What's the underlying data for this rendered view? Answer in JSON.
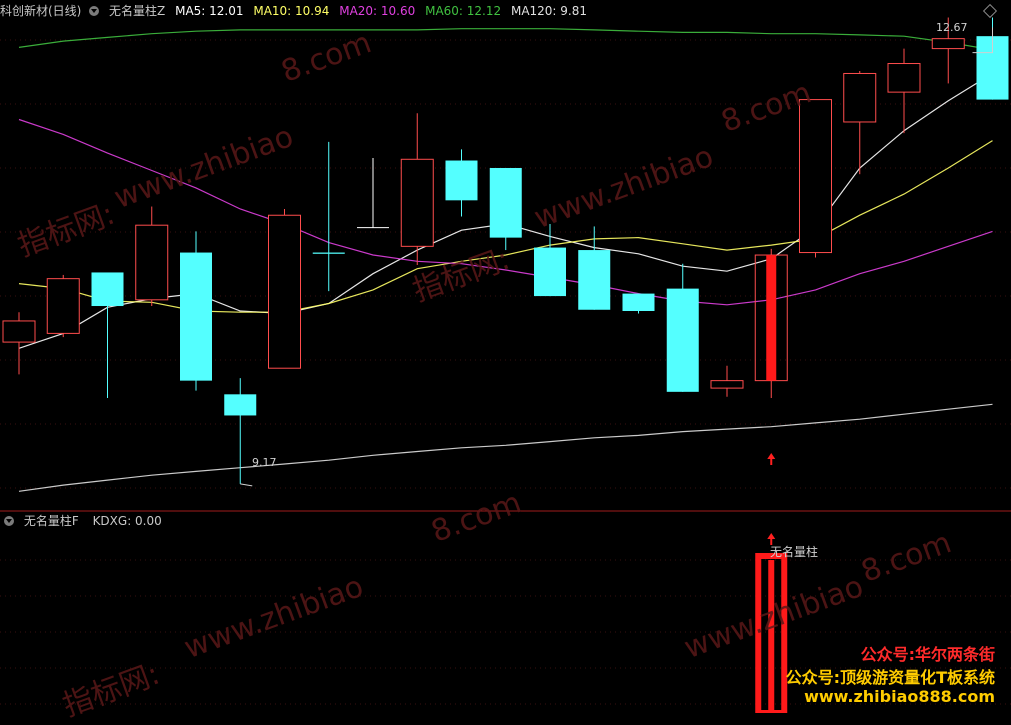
{
  "top_panel": {
    "title": "科创新材(日线)",
    "indicator": "无名量柱Z",
    "ma5": "MA5: 12.01",
    "ma10": "MA10: 10.94",
    "ma20": "MA20: 10.60",
    "ma60": "MA60: 12.12",
    "ma120": "MA120: 9.81",
    "high_label": "12.67",
    "low_label": "9.17"
  },
  "bottom_panel": {
    "indicator": "无名量柱F",
    "kdxg": "KDXG: 0.00",
    "signal_label": "无名量柱"
  },
  "watermarks": [
    "指标网:",
    "www.zhibiao",
    "8.com"
  ],
  "promo": {
    "line1": "公众号:华尔两条街",
    "line2": "公众号:顶级游资量化T板系统",
    "line3": "www.zhibiao888.com"
  },
  "colors": {
    "up": "#ff4d4d",
    "down": "#54ffff",
    "signal": "#ff1a1a",
    "ma5": "#ffffff",
    "ma10": "#ffff66",
    "ma20": "#e040e0",
    "ma60": "#40c040",
    "ma120": "#e0e0e0"
  },
  "chart_data": {
    "type": "candlestick",
    "ylim": [
      9.0,
      12.9
    ],
    "candles": [
      {
        "o": 10.31,
        "c": 10.48,
        "h": 10.55,
        "l": 10.05
      },
      {
        "o": 10.38,
        "c": 10.82,
        "h": 10.85,
        "l": 10.35
      },
      {
        "o": 10.87,
        "c": 10.6,
        "h": 10.87,
        "l": 9.86
      },
      {
        "o": 10.65,
        "c": 11.25,
        "h": 11.4,
        "l": 10.6
      },
      {
        "o": 11.03,
        "c": 10.0,
        "h": 11.2,
        "l": 9.92
      },
      {
        "o": 9.89,
        "c": 9.72,
        "h": 10.02,
        "l": 9.17
      },
      {
        "o": 10.1,
        "c": 11.33,
        "h": 11.38,
        "l": 10.1
      },
      {
        "o": 11.03,
        "c": 11.02,
        "h": 11.92,
        "l": 10.72
      },
      {
        "o": 11.23,
        "c": 11.23,
        "h": 11.79,
        "l": 11.23
      },
      {
        "o": 11.08,
        "c": 11.78,
        "h": 12.15,
        "l": 10.93
      },
      {
        "o": 11.77,
        "c": 11.45,
        "h": 11.86,
        "l": 11.32
      },
      {
        "o": 11.71,
        "c": 11.15,
        "h": 11.71,
        "l": 11.05
      },
      {
        "o": 11.07,
        "c": 10.68,
        "h": 11.26,
        "l": 10.68
      },
      {
        "o": 11.05,
        "c": 10.57,
        "h": 11.24,
        "l": 10.57
      },
      {
        "o": 10.7,
        "c": 10.56,
        "h": 10.7,
        "l": 10.54
      },
      {
        "o": 10.74,
        "c": 9.91,
        "h": 10.94,
        "l": 9.91
      },
      {
        "o": 9.94,
        "c": 10.0,
        "h": 10.12,
        "l": 9.87
      },
      {
        "o": 10.0,
        "c": 11.01,
        "h": 11.06,
        "l": 9.86
      },
      {
        "o": 11.03,
        "c": 12.26,
        "h": 12.26,
        "l": 10.99
      },
      {
        "o": 12.08,
        "c": 12.47,
        "h": 12.49,
        "l": 11.66
      },
      {
        "o": 12.32,
        "c": 12.55,
        "h": 12.67,
        "l": 11.99
      },
      {
        "o": 12.67,
        "c": 12.75,
        "h": 12.92,
        "l": 12.39
      },
      {
        "o": 12.77,
        "c": 12.26,
        "h": 12.92,
        "l": 12.26
      }
    ],
    "signal_index": 17,
    "ma_series": [
      {
        "name": "MA5",
        "values": [
          10.26,
          10.38,
          10.59,
          10.66,
          10.7,
          10.56,
          10.54,
          10.62,
          10.86,
          11.05,
          11.21,
          11.26,
          11.16,
          11.07,
          11.02,
          10.92,
          10.88,
          10.98,
          11.23,
          11.71,
          12.01,
          12.25,
          12.47
        ]
      },
      {
        "name": "MA10",
        "values": [
          10.78,
          10.74,
          10.64,
          10.63,
          10.56,
          10.55,
          10.55,
          10.62,
          10.73,
          10.9,
          10.96,
          11.01,
          11.09,
          11.14,
          11.15,
          11.1,
          11.05,
          11.09,
          11.14,
          11.33,
          11.5,
          11.71,
          11.93
        ]
      },
      {
        "name": "MA20",
        "values": [
          12.1,
          11.98,
          11.83,
          11.69,
          11.55,
          11.38,
          11.26,
          11.11,
          11.01,
          10.96,
          10.94,
          10.89,
          10.83,
          10.77,
          10.7,
          10.64,
          10.61,
          10.65,
          10.73,
          10.86,
          10.96,
          11.08,
          11.2
        ]
      },
      {
        "name": "MA60",
        "values": [
          12.68,
          12.73,
          12.76,
          12.79,
          12.81,
          12.82,
          12.82,
          12.82,
          12.82,
          12.82,
          12.83,
          12.83,
          12.83,
          12.82,
          12.81,
          12.8,
          12.8,
          12.79,
          12.79,
          12.78,
          12.77,
          12.72,
          12.66
        ]
      },
      {
        "name": "MA120",
        "values": [
          9.11,
          9.16,
          9.2,
          9.24,
          9.27,
          9.3,
          9.33,
          9.36,
          9.4,
          9.43,
          9.46,
          9.48,
          9.51,
          9.54,
          9.56,
          9.59,
          9.61,
          9.63,
          9.66,
          9.69,
          9.73,
          9.77,
          9.81
        ]
      }
    ]
  }
}
